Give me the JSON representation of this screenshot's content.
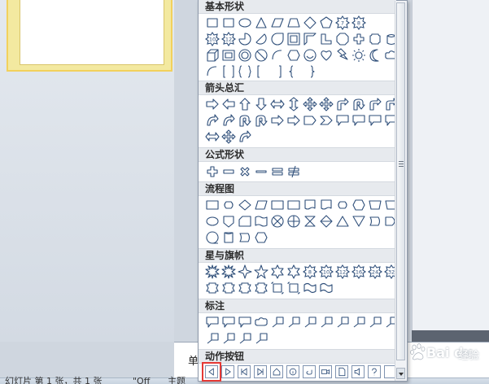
{
  "shapes_menu": {
    "categories": [
      {
        "label": "基本形状"
      },
      {
        "label": "箭头总汇"
      },
      {
        "label": "公式形状"
      },
      {
        "label": "流程图"
      },
      {
        "label": "星与旗帜"
      },
      {
        "label": "标注"
      },
      {
        "label": "动作按钮"
      }
    ],
    "basic_badges": [
      "7",
      "8",
      "10",
      "12"
    ],
    "star_badges": [
      "8",
      "10",
      "12",
      "16",
      "24",
      "32"
    ]
  },
  "notes": {
    "prefix": "单"
  },
  "status_bar": {
    "slide_info": "幻灯片 第 1 张，共 1 张",
    "theme_quoted": "\"Off",
    "theme_label": "主题"
  },
  "watermark": {
    "text": "Bai du",
    "sub": "经验"
  },
  "colors": {
    "shape_stroke": "#2f4f7a",
    "highlight": "#e53935",
    "slide_border": "#f2d15c"
  }
}
